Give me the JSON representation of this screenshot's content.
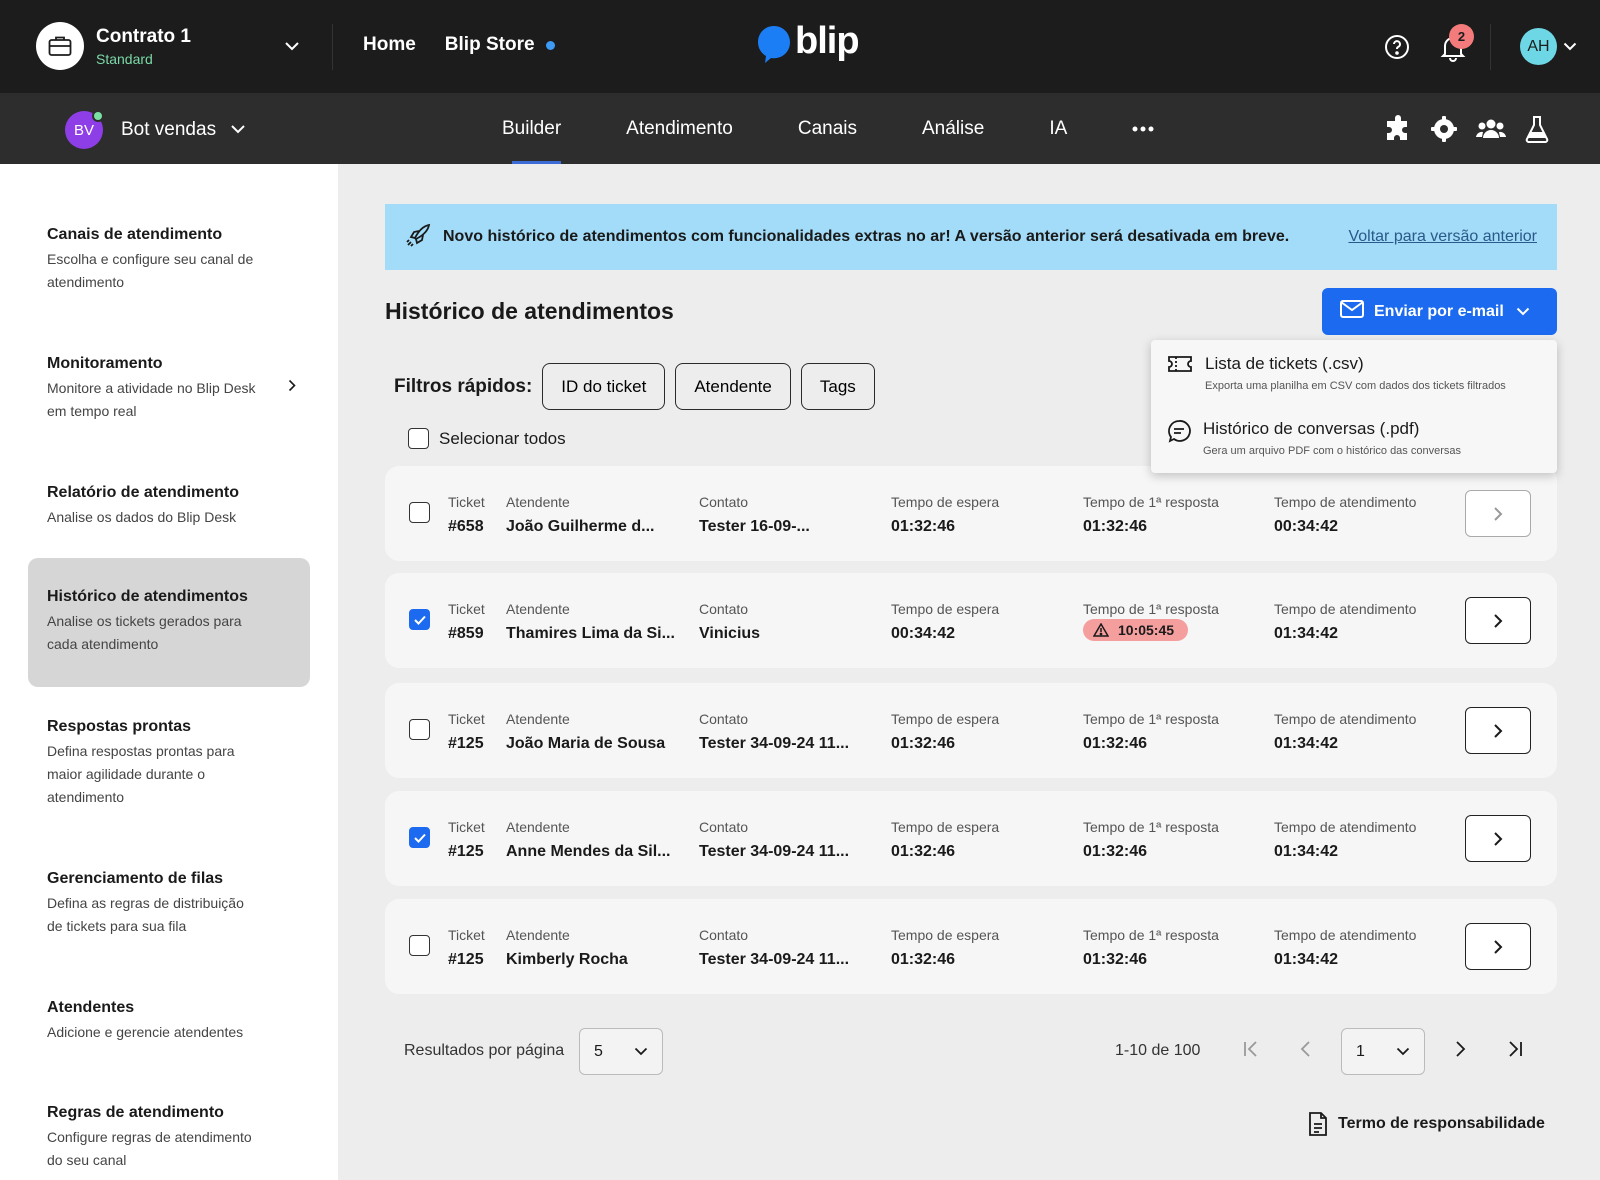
{
  "topbar": {
    "contract_name": "Contrato 1",
    "contract_plan": "Standard",
    "nav": [
      "Home",
      "Blip Store"
    ],
    "logo_text": "blip",
    "notification_count": "2",
    "user_initials": "AH"
  },
  "subbar": {
    "bot_initials": "BV",
    "bot_name": "Bot vendas",
    "modules": [
      "Builder",
      "Atendimento",
      "Canais",
      "Análise",
      "IA"
    ],
    "active_module": "Builder"
  },
  "sidebar": {
    "items": [
      {
        "title": "Canais de atendimento",
        "desc": "Escolha e configure seu canal de atendimento"
      },
      {
        "title": "Monitoramento",
        "desc": "Monitore a atividade no Blip Desk em tempo real"
      },
      {
        "title": "Relatório de atendimento",
        "desc": "Analise os dados do Blip Desk"
      },
      {
        "title": "Histórico de atendimentos",
        "desc": "Analise os tickets gerados para cada atendimento"
      },
      {
        "title": "Respostas prontas",
        "desc": "Defina respostas prontas para maior agilidade durante o atendimento"
      },
      {
        "title": "Gerenciamento de filas",
        "desc": "Defina as regras de distribuição de tickets para sua fila"
      },
      {
        "title": "Atendentes",
        "desc": "Adicione e gerencie atendentes"
      },
      {
        "title": "Regras de atendimento",
        "desc": "Configure regras de atendimento do seu canal"
      }
    ]
  },
  "banner": {
    "text": "Novo histórico de atendimentos com funcionalidades extras no ar! A versão anterior será desativada em breve.",
    "link": "Voltar para versão anterior"
  },
  "main": {
    "title": "Histórico de atendimentos",
    "email_button": "Enviar por e-mail",
    "filters_label": "Filtros rápidos:",
    "filters": [
      "ID do ticket",
      "Atendente",
      "Tags"
    ],
    "select_all": "Selecionar todos"
  },
  "dropdown": {
    "items": [
      {
        "title": "Lista de tickets (.csv)",
        "desc": "Exporta uma planilha em CSV com dados dos tickets filtrados"
      },
      {
        "title": "Histórico de conversas (.pdf)",
        "desc": "Gera um arquivo PDF com o histórico das conversas"
      }
    ]
  },
  "columns": [
    "Ticket",
    "Atendente",
    "Contato",
    "Tempo de espera",
    "Tempo de 1ª resposta",
    "Tempo de atendimento"
  ],
  "tickets": [
    {
      "checked": false,
      "ticket": "#658",
      "agent": "João Guilherme d...",
      "contact": "Tester 16-09-...",
      "wait": "01:32:46",
      "first_response": "01:32:46",
      "first_response_alert": false,
      "duration": "00:34:42"
    },
    {
      "checked": true,
      "ticket": "#859",
      "agent": "Thamires Lima da Si...",
      "contact": "Vinicius",
      "wait": "00:34:42",
      "first_response": "10:05:45",
      "first_response_alert": true,
      "duration": "01:34:42"
    },
    {
      "checked": false,
      "ticket": "#125",
      "agent": "João Maria de Sousa",
      "contact": "Tester 34-09-24 11...",
      "wait": "01:32:46",
      "first_response": "01:32:46",
      "first_response_alert": false,
      "duration": "01:34:42"
    },
    {
      "checked": true,
      "ticket": "#125",
      "agent": "Anne Mendes da Sil...",
      "contact": "Tester 34-09-24 11...",
      "wait": "01:32:46",
      "first_response": "01:32:46",
      "first_response_alert": false,
      "duration": "01:34:42"
    },
    {
      "checked": false,
      "ticket": "#125",
      "agent": "Kimberly Rocha",
      "contact": "Tester 34-09-24 11...",
      "wait": "01:32:46",
      "first_response": "01:32:46",
      "first_response_alert": false,
      "duration": "01:34:42"
    }
  ],
  "pagination": {
    "per_page_label": "Resultados por página",
    "per_page": "5",
    "range": "1-10 de 100",
    "page": "1"
  },
  "footer": {
    "terms": "Termo de responsabilidade"
  },
  "colors": {
    "primary": "#1c6af0",
    "banner": "#a3dcf8",
    "alert": "#f59e9e",
    "topbar": "#1c1c1c"
  }
}
